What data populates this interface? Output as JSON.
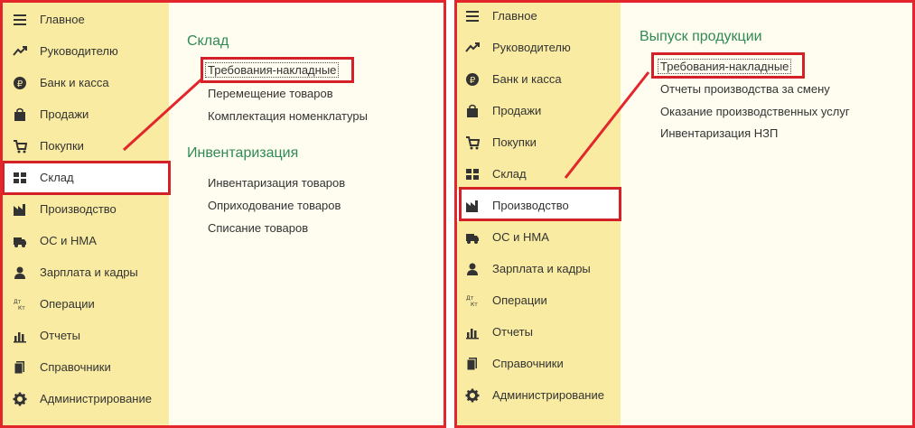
{
  "left_panel": {
    "nav_items": [
      {
        "icon": "menu-icon",
        "label": "Главное"
      },
      {
        "icon": "trend-icon",
        "label": "Руководителю"
      },
      {
        "icon": "ruble-icon",
        "label": "Банк и касса"
      },
      {
        "icon": "bag-icon",
        "label": "Продажи"
      },
      {
        "icon": "cart-icon",
        "label": "Покупки"
      },
      {
        "icon": "warehouse-icon",
        "label": "Склад"
      },
      {
        "icon": "factory-icon",
        "label": "Производство"
      },
      {
        "icon": "truck-icon",
        "label": "ОС и НМА"
      },
      {
        "icon": "person-icon",
        "label": "Зарплата и кадры"
      },
      {
        "icon": "dtkt-icon",
        "label": "Операции"
      },
      {
        "icon": "bar-chart-icon",
        "label": "Отчеты"
      },
      {
        "icon": "books-icon",
        "label": "Справочники"
      },
      {
        "icon": "gear-icon",
        "label": "Администрирование"
      }
    ],
    "active_item": "Склад",
    "sections": [
      {
        "title": "Склад",
        "links": [
          "Требования-накладные",
          "Перемещение товаров",
          "Комплектация номенклатуры"
        ]
      },
      {
        "title": "Инвентаризация",
        "links": [
          "Инвентаризация товаров",
          "Оприходование товаров",
          "Списание товаров"
        ]
      }
    ]
  },
  "right_panel": {
    "nav_items": [
      {
        "icon": "menu-icon",
        "label": "Главное"
      },
      {
        "icon": "trend-icon",
        "label": "Руководителю"
      },
      {
        "icon": "ruble-icon",
        "label": "Банк и касса"
      },
      {
        "icon": "bag-icon",
        "label": "Продажи"
      },
      {
        "icon": "cart-icon",
        "label": "Покупки"
      },
      {
        "icon": "warehouse-icon",
        "label": "Склад"
      },
      {
        "icon": "factory-icon",
        "label": "Производство"
      },
      {
        "icon": "truck-icon",
        "label": "ОС и НМА"
      },
      {
        "icon": "person-icon",
        "label": "Зарплата и кадры"
      },
      {
        "icon": "dtkt-icon",
        "label": "Операции"
      },
      {
        "icon": "bar-chart-icon",
        "label": "Отчеты"
      },
      {
        "icon": "books-icon",
        "label": "Справочники"
      },
      {
        "icon": "gear-icon",
        "label": "Администрирование"
      }
    ],
    "active_item": "Производство",
    "sections": [
      {
        "title": "Выпуск продукции",
        "links": [
          "Требования-накладные",
          "Отчеты производства за смену",
          "Оказание производственных услуг",
          "Инвентаризация НЗП"
        ]
      }
    ]
  },
  "colors": {
    "sidebar_bg": "#faeba2",
    "content_bg": "#fffdf0",
    "section_title": "#2f8a55",
    "highlight": "#e3262b",
    "text": "#333333"
  }
}
